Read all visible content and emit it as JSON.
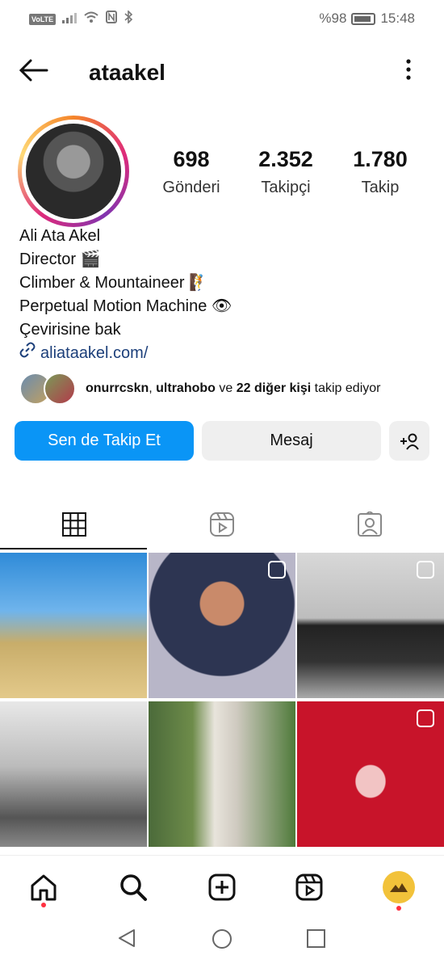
{
  "status_bar": {
    "network_chip": "VoLTE",
    "battery_text": "%98",
    "time": "15:48"
  },
  "header": {
    "username": "ataakel"
  },
  "stats": {
    "posts": {
      "value": "698",
      "label": "Gönderi"
    },
    "followers": {
      "value": "2.352",
      "label": "Takipçi"
    },
    "following": {
      "value": "1.780",
      "label": "Takip"
    }
  },
  "bio": {
    "name": "Ali Ata Akel",
    "line1": "Director 🎬",
    "line2": "Climber & Mountaineer 🧗",
    "line3": "Perpetual Motion Machine 👁",
    "translate": "Çevirisine bak",
    "link": "aliataakel.com/"
  },
  "followed_by": {
    "user1": "onurrcskn",
    "sep": ", ",
    "user2": "ultrahobo",
    "and": " ve ",
    "others": "22 diğer kişi",
    "suffix": " takip ediyor"
  },
  "actions": {
    "follow": "Sen de Takip Et",
    "message": "Mesaj",
    "add_person": "+👤"
  },
  "tabs": [
    "grid-icon",
    "reels-icon",
    "tagged-icon"
  ],
  "bottom_nav": [
    "home-icon",
    "search-icon",
    "create-icon",
    "reels-icon",
    "profile-avatar"
  ],
  "colors": {
    "follow_button": "#0a95f6",
    "notification_dot": "#ff3040"
  }
}
